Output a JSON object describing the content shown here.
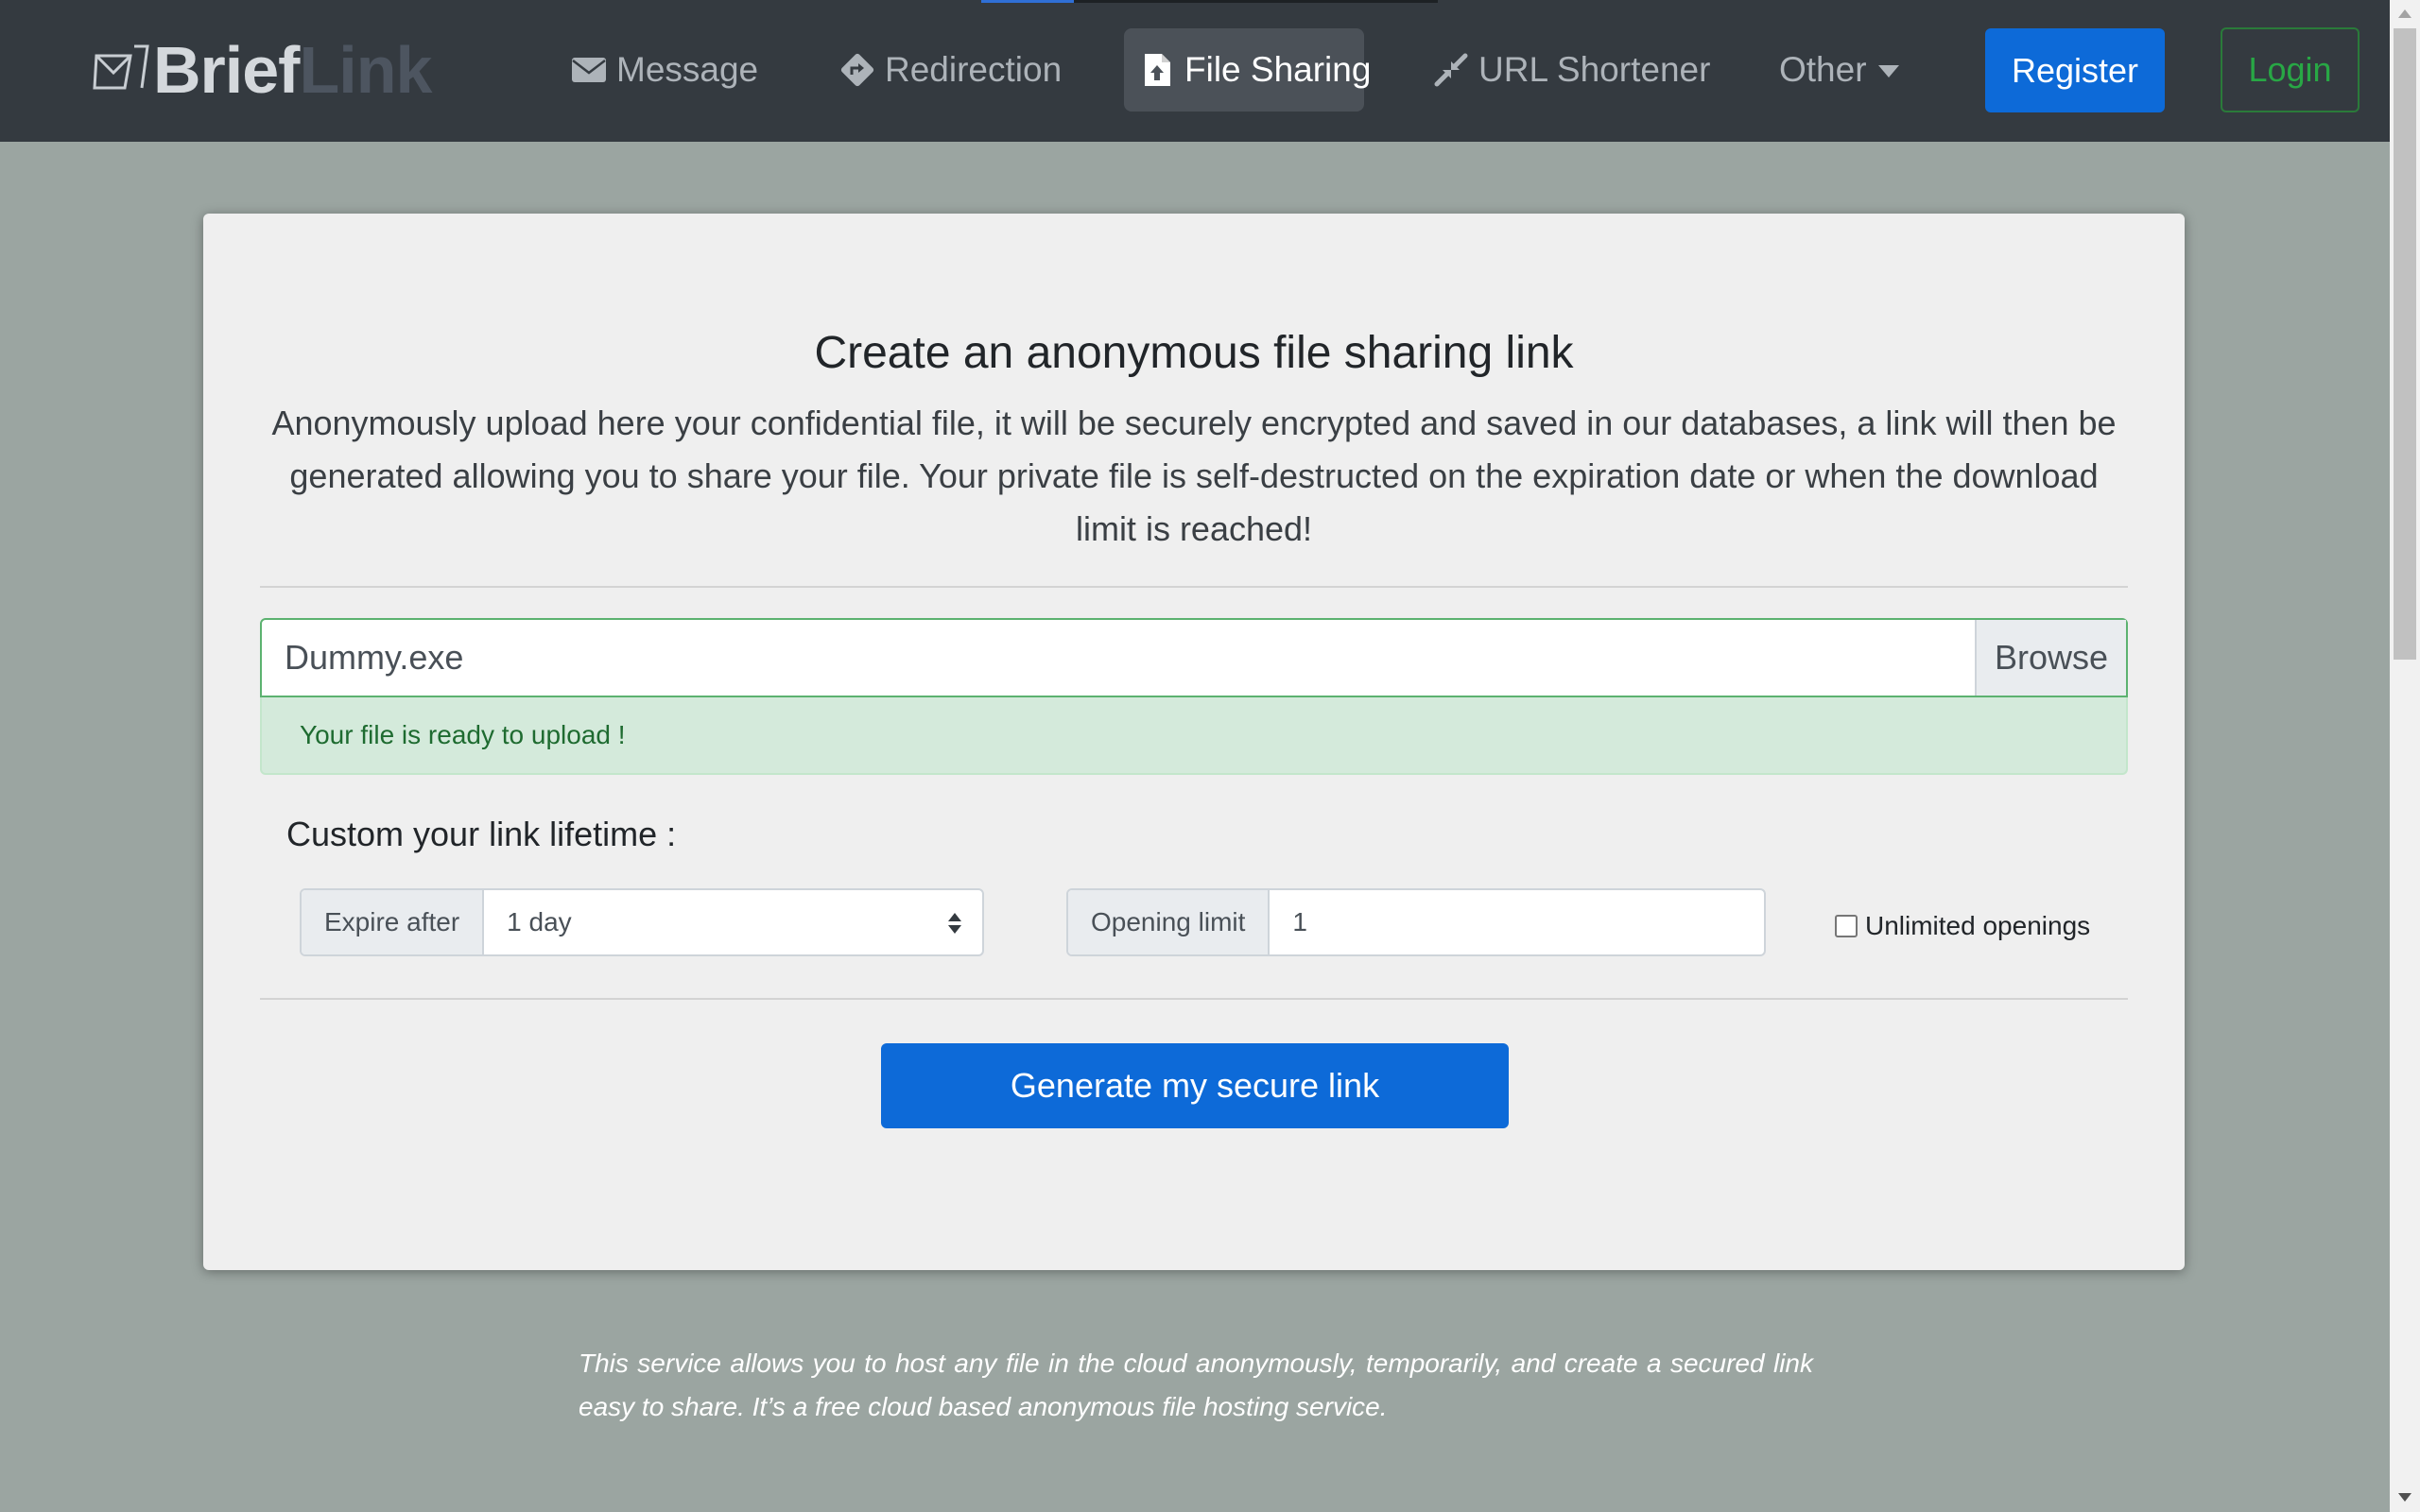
{
  "brand": {
    "part1": "Brief",
    "part2": "Link",
    "icon": "envelope-logo-icon"
  },
  "nav": {
    "items": [
      {
        "label": "Message",
        "icon": "envelope-icon"
      },
      {
        "label": "Redirection",
        "icon": "direction-sign-icon"
      },
      {
        "label": "File Sharing",
        "icon": "file-upload-icon",
        "active": true
      },
      {
        "label": "URL Shortener",
        "icon": "compress-arrows-icon"
      },
      {
        "label": "Other",
        "icon": "caret-down-icon"
      }
    ],
    "register_label": "Register",
    "login_label": "Login"
  },
  "card": {
    "title": "Create an anonymous file sharing link",
    "description": "Anonymously upload here your confidential file, it will be securely encrypted and saved in our databases, a link will then be generated allowing you to share your file. Your private file is self-destructed on the expiration date or when the download limit is reached!",
    "file": {
      "name": "Dummy.exe",
      "browse_label": "Browse"
    },
    "alert": "Your file is ready to upload !",
    "lifetime_label": "Custom your link lifetime :",
    "expire": {
      "label": "Expire after",
      "value": "1 day"
    },
    "opening": {
      "label": "Opening limit",
      "value": "1"
    },
    "unlimited_label": "Unlimited openings",
    "unlimited_checked": false,
    "generate_label": "Generate my secure link"
  },
  "footer_note": "This service allows you to host any file in the cloud anonymously, temporarily, and create a secured link easy to share. It’s a free cloud based anonymous file hosting service.",
  "colors": {
    "navbar": "#343a40",
    "page_bg": "#9ba5a1",
    "primary": "#0d6ad8",
    "success": "#28a745",
    "alert_bg": "#d4eadb"
  }
}
